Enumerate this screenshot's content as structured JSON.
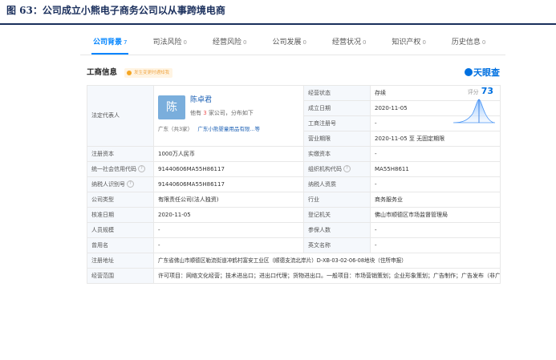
{
  "figure": {
    "title": "图 63：公司成立小熊电子商务公司以从事跨境电商"
  },
  "tabs": [
    {
      "label": "公司背景",
      "count": "7"
    },
    {
      "label": "司法风险",
      "count": "0"
    },
    {
      "label": "经营风险",
      "count": "0"
    },
    {
      "label": "公司发展",
      "count": "0"
    },
    {
      "label": "经营状况",
      "count": "0"
    },
    {
      "label": "知识产权",
      "count": "0"
    },
    {
      "label": "历史信息",
      "count": "0"
    }
  ],
  "section": {
    "title": "工商信息",
    "badge": "发生变更时通知我",
    "brand": "天眼查"
  },
  "rep": {
    "label": "法定代表人",
    "avatar": "陈",
    "name": "陈卓君",
    "sub_prefix": "他有",
    "sub_count": "3",
    "sub_suffix": "家公司，分布如下",
    "loc_a": "广东（共3家）",
    "loc_b": "广东小熊婴童用品有限...等"
  },
  "right_top": [
    {
      "label": "经营状态",
      "value": "存续"
    },
    {
      "label": "成立日期",
      "value": "2020-11-05"
    },
    {
      "label": "工商注册号",
      "value": "-"
    }
  ],
  "score": {
    "label": "评分",
    "value": "73"
  },
  "term": {
    "label": "营业期限",
    "value": "2020-11-05 至 无固定期限"
  },
  "rows": [
    {
      "l1": "注册资本",
      "v1": "1000万人民币",
      "l2": "实缴资本",
      "v2": "-"
    },
    {
      "l1": "统一社会信用代码",
      "v1": "91440606MA55H86117",
      "l2": "组织机构代码",
      "v2": "MA55H8611"
    },
    {
      "l1": "纳税人识别号",
      "v1": "91440606MA55H86117",
      "l2": "纳税人资质",
      "v2": "-"
    },
    {
      "l1": "公司类型",
      "v1": "有限责任公司(法人独资)",
      "l2": "行业",
      "v2": "商务服务业"
    },
    {
      "l1": "核准日期",
      "v1": "2020-11-05",
      "l2": "登记机关",
      "v2": "佛山市顺德区市场监督管理局"
    },
    {
      "l1": "人员规模",
      "v1": "-",
      "l2": "参保人数",
      "v2": "-"
    },
    {
      "l1": "曾用名",
      "v1": "-",
      "l2": "英文名称",
      "v2": "-"
    }
  ],
  "address": {
    "label": "注册地址",
    "value": "广东省佛山市顺德区勒流街道冲鹤村富安工业区（顺德支流北岸片）D-XB-03-02-06-08地块（住所申报）"
  },
  "scope": {
    "label": "经营范围",
    "value": "许可项目：网络文化经营；技术进出口；进出口代理；货物进出口。一般项目：市场营销策划；企业形象策划；广告制作；广告发布（非广播电台、电视台、报刊出版单位）；广告设计、代理；社会经济咨询服务；市场调查（不含涉外调查）；互联网销售（除销售需要许可的商品）；家用电器研发；家用电器销售；家用电器零配件销售；母婴用品销售；日用品销售；信息咨询服务（不含许可类信息咨询服务）；国内贸易代理；非居住房地产租赁；物业管理。(依法须经批准的项目，经相关部门批准后方可开展经营活动)"
  }
}
